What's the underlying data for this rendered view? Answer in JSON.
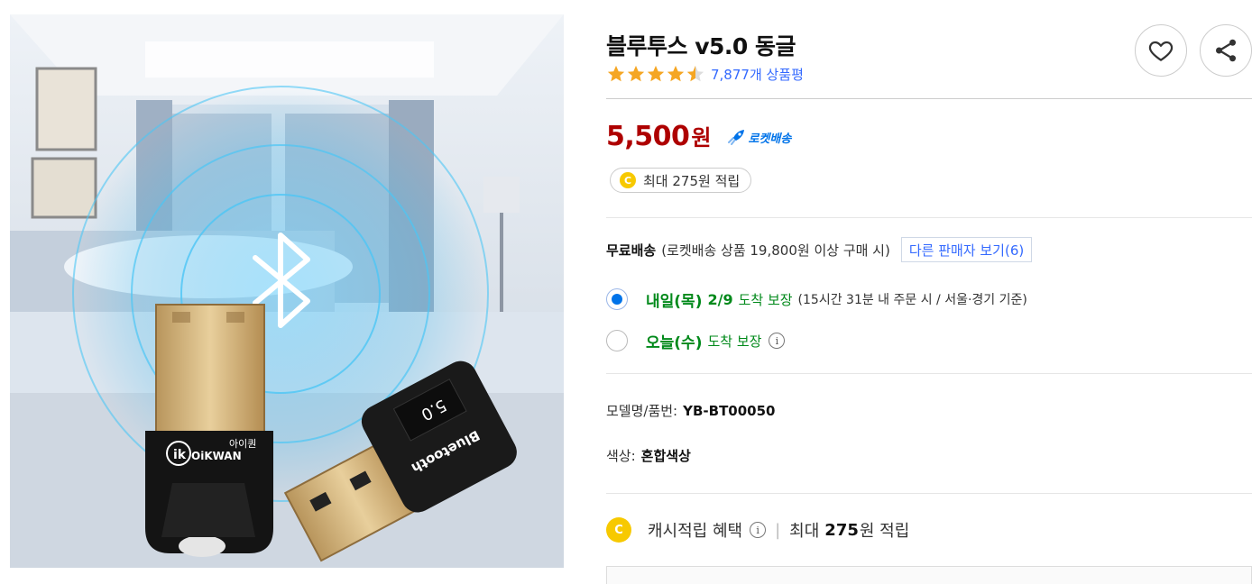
{
  "product": {
    "title": "블루투스 v5.0 동글",
    "rating": 4.5,
    "review_count": "7,877개 상품평",
    "image_labels": {
      "version": "5.0",
      "device_text": "Bluetooth",
      "brand_kr": "아이퀀",
      "brand_en": "OiKWAN"
    }
  },
  "actions": {
    "wishlist_icon": "heart-icon",
    "share_icon": "share-icon"
  },
  "price": {
    "value": "5,500",
    "unit": "원",
    "rocket_label": "로켓배송"
  },
  "cash": {
    "coin_symbol": "C",
    "pill_text": "최대 275원 적립"
  },
  "shipping": {
    "free_label": "무료배송",
    "note": "(로켓배송 상품 19,800원 이상 구매 시)",
    "other_sellers_button": "다른 판매자 보기(6)"
  },
  "delivery_options": [
    {
      "selected": true,
      "day": "내일(목)",
      "date": "2/9",
      "guarantee": "도착 보장",
      "condition": "(15시간 31분 내 주문 시 / 서울·경기 기준)"
    },
    {
      "selected": false,
      "day": "오늘(수)",
      "guarantee": "도착 보장",
      "info_icon": "i"
    }
  ],
  "attributes": {
    "model_label": "모델명/품번:",
    "model_value": "YB-BT00050",
    "color_label": "색상:",
    "color_value": "혼합색상"
  },
  "cash_benefit": {
    "label": "캐시적립 혜택",
    "info_icon": "i",
    "separator": "|",
    "prefix": "최대",
    "amount": "275",
    "suffix": "원 적립"
  },
  "colors": {
    "price": "#ae0000",
    "link": "#346aff",
    "rocket": "#0073e9",
    "delivery_green": "#00891a",
    "coin": "#f7c900",
    "star": "#f5a623"
  }
}
